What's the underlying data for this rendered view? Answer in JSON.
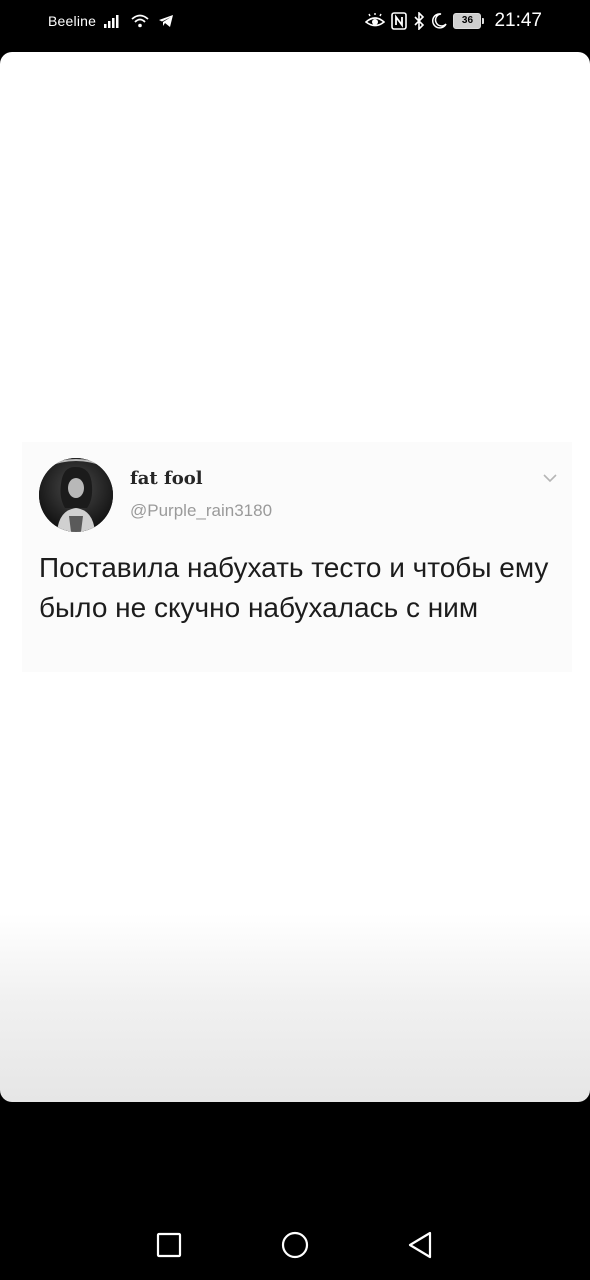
{
  "status_bar": {
    "carrier": "Beeline",
    "battery_level": "36",
    "time": "21:47"
  },
  "tweet": {
    "display_name": "fat fool",
    "handle": "@Purple_rain3180",
    "text": "Поставила набухать тесто и чтобы ему было не скучно набухалась с ним"
  },
  "icons": {
    "status": [
      "signal-icon",
      "wifi-icon",
      "telegram-icon",
      "eye-comfort-icon",
      "nfc-icon",
      "bluetooth-icon",
      "do-not-disturb-icon",
      "battery-icon"
    ],
    "tweet": [
      "avatar",
      "chevron-down-icon"
    ],
    "nav": [
      "recent-apps-icon",
      "home-icon",
      "back-icon"
    ]
  },
  "colors": {
    "background": "#000000",
    "card": "#ffffff",
    "handle": "#9a9a9a",
    "text": "#1c1c1c"
  }
}
